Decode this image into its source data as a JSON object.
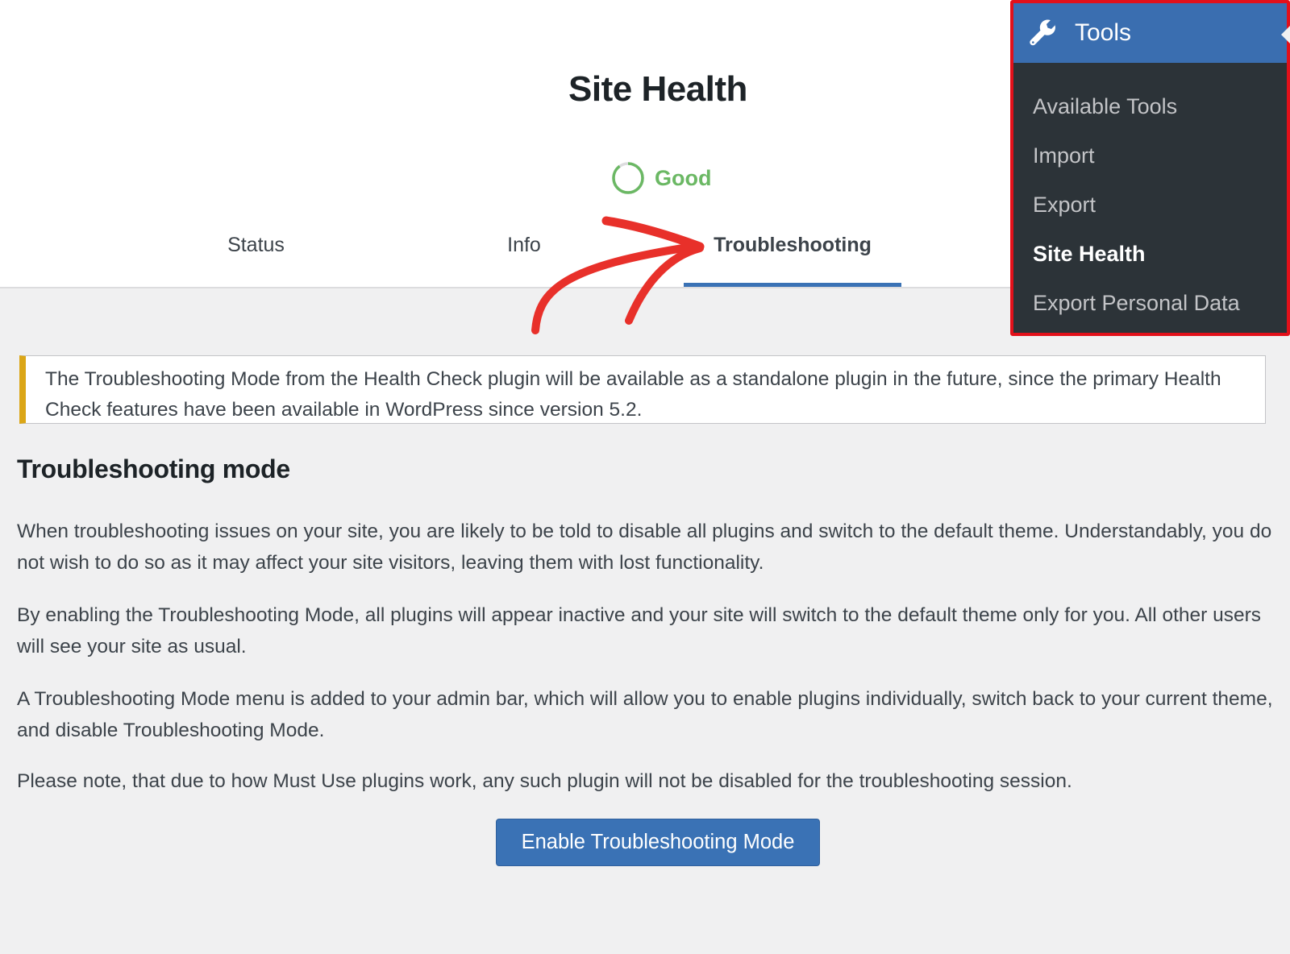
{
  "header": {
    "title": "Site Health",
    "status": {
      "label": "Good",
      "color": "#6bb864",
      "score_fraction": 0.9
    },
    "tabs": [
      {
        "label": "Status",
        "active": false
      },
      {
        "label": "Info",
        "active": false
      },
      {
        "label": "Troubleshooting",
        "active": true
      }
    ]
  },
  "notice": {
    "text": "The Troubleshooting Mode from the Health Check plugin will be available as a standalone plugin in the future, since the primary Health Check features have been available in WordPress since version 5.2.",
    "accent_color": "#dba617"
  },
  "main": {
    "section_title": "Troubleshooting mode",
    "paragraphs": [
      "When troubleshooting issues on your site, you are likely to be told to disable all plugins and switch to the default theme. Understandably, you do not wish to do so as it may affect your site visitors, leaving them with lost functionality.",
      "By enabling the Troubleshooting Mode, all plugins will appear inactive and your site will switch to the default theme only for you. All other users will see your site as usual.",
      "A Troubleshooting Mode menu is added to your admin bar, which will allow you to enable plugins individually, switch back to your current theme, and disable Troubleshooting Mode.",
      "Please note, that due to how Must Use plugins work, any such plugin will not be disabled for the troubleshooting session."
    ],
    "enable_button_label": "Enable Troubleshooting Mode"
  },
  "admin_menu": {
    "parent": {
      "label": "Tools",
      "icon": "wrench-icon"
    },
    "items": [
      {
        "label": "Available Tools",
        "current": false
      },
      {
        "label": "Import",
        "current": false
      },
      {
        "label": "Export",
        "current": false
      },
      {
        "label": "Site Health",
        "current": true
      },
      {
        "label": "Export Personal Data",
        "current": false
      }
    ],
    "highlight_color": "#e2101a"
  },
  "annotation": {
    "type": "arrow",
    "color": "#e8302a",
    "points_to": "Troubleshooting"
  }
}
